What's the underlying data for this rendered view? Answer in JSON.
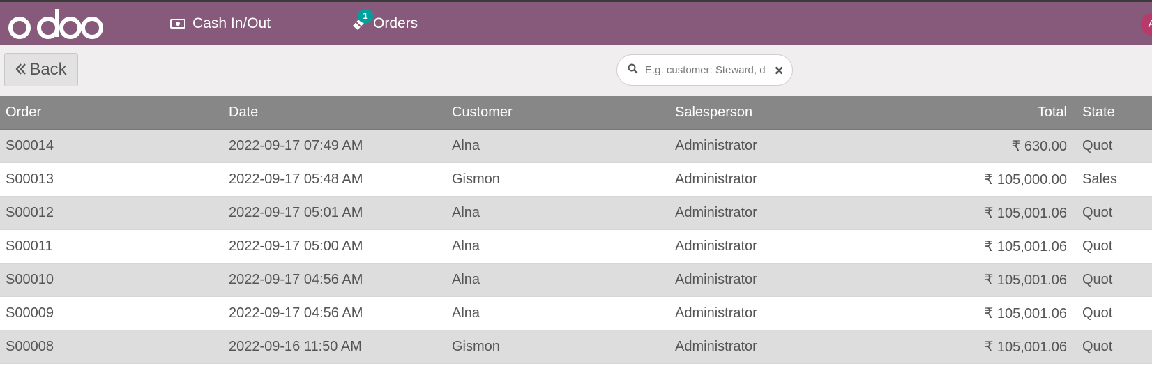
{
  "navbar": {
    "logo_text": "odoo",
    "cash_label": "Cash In/Out",
    "orders_label": "Orders",
    "orders_badge": "1",
    "avatar_initial": "A"
  },
  "controls": {
    "back_label": "Back",
    "search_placeholder": "E.g. customer: Steward, d"
  },
  "table": {
    "headers": {
      "order": "Order",
      "date": "Date",
      "customer": "Customer",
      "salesperson": "Salesperson",
      "total": "Total",
      "state": "State"
    },
    "rows": [
      {
        "order": "S00014",
        "date": "2022-09-17 07:49 AM",
        "customer": "Alna",
        "salesperson": "Administrator",
        "total": "₹ 630.00",
        "state": "Quot"
      },
      {
        "order": "S00013",
        "date": "2022-09-17 05:48 AM",
        "customer": "Gismon",
        "salesperson": "Administrator",
        "total": "₹ 105,000.00",
        "state": "Sales"
      },
      {
        "order": "S00012",
        "date": "2022-09-17 05:01 AM",
        "customer": "Alna",
        "salesperson": "Administrator",
        "total": "₹ 105,001.06",
        "state": "Quot"
      },
      {
        "order": "S00011",
        "date": "2022-09-17 05:00 AM",
        "customer": "Alna",
        "salesperson": "Administrator",
        "total": "₹ 105,001.06",
        "state": "Quot"
      },
      {
        "order": "S00010",
        "date": "2022-09-17 04:56 AM",
        "customer": "Alna",
        "salesperson": "Administrator",
        "total": "₹ 105,001.06",
        "state": "Quot"
      },
      {
        "order": "S00009",
        "date": "2022-09-17 04:56 AM",
        "customer": "Alna",
        "salesperson": "Administrator",
        "total": "₹ 105,001.06",
        "state": "Quot"
      },
      {
        "order": "S00008",
        "date": "2022-09-16 11:50 AM",
        "customer": "Gismon",
        "salesperson": "Administrator",
        "total": "₹ 105,001.06",
        "state": "Quot"
      }
    ]
  },
  "colors": {
    "navbar": "#875a7b",
    "badge": "#00a09d",
    "header_row": "#878787"
  }
}
